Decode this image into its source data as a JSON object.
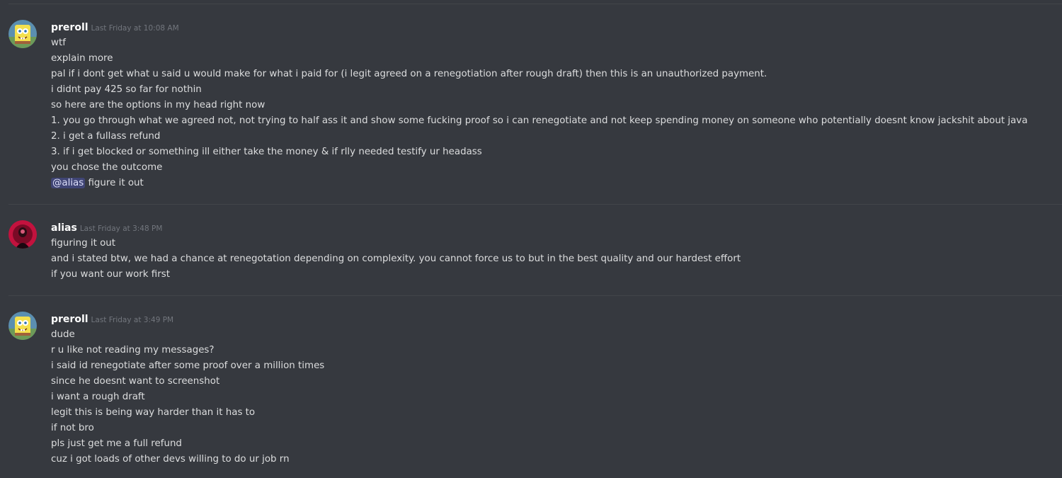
{
  "colors": {
    "background": "#36393f",
    "text": "#dcddde",
    "username": "#ffffff",
    "timestamp": "#72767d",
    "mention_bg": "rgba(88,101,242,0.3)",
    "mention_text": "#dee0fc",
    "divider": "#42454a"
  },
  "messages": [
    {
      "avatar_icon": "spongebob-avatar-icon",
      "username": "preroll",
      "timestamp": "Last Friday at 10:08 AM",
      "lines": [
        "wtf",
        "explain more",
        "pal if i dont get what u said u would make for what i paid for (i legit agreed on a renegotiation after rough draft) then this is an unauthorized payment.",
        "i didnt pay 425 so far for nothin",
        "so here are the options in my head right now",
        "1. you go through what we agreed not, not trying to half ass it and show some fucking proof so i can renegotiate and not keep spending money on someone who potentially doesnt know jackshit about java",
        "2. i get a fullass refund",
        "3. if i get blocked or something ill either take the money & if rlly needed testify ur headass",
        "you chose the outcome"
      ],
      "mention_line": {
        "mention": "@alias",
        "text": " figure it out"
      }
    },
    {
      "avatar_icon": "alias-avatar-icon",
      "username": "alias",
      "timestamp": "Last Friday at 3:48 PM",
      "lines": [
        "figuring it out",
        "and i stated btw, we had a chance at renegotation depending on complexity. you cannot force us to but in the best quality and our hardest effort",
        "if you want our work first"
      ]
    },
    {
      "avatar_icon": "spongebob-avatar-icon",
      "username": "preroll",
      "timestamp": "Last Friday at 3:49 PM",
      "lines": [
        "dude",
        "r u like not reading my messages?",
        "i said id renegotiate after some proof over a million times",
        "since he doesnt want to screenshot",
        "i want a rough draft",
        "legit this is being way harder than it has to",
        "if not bro",
        "pls just get me a full refund",
        "cuz i got loads of other devs willing to do ur job rn"
      ]
    }
  ]
}
